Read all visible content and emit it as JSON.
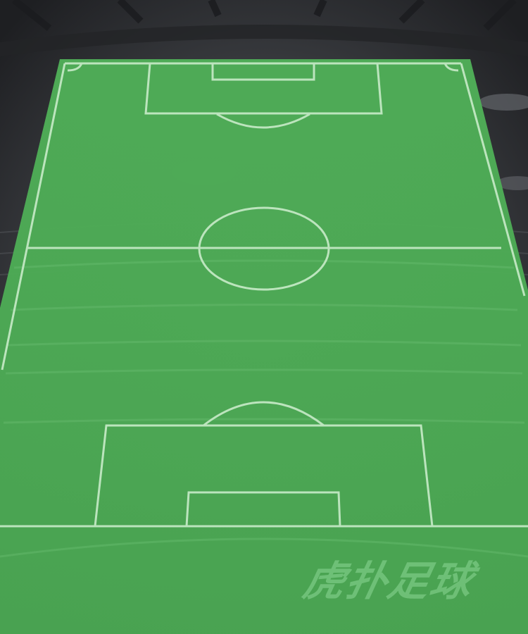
{
  "watermark": {
    "text": "虎扑足球"
  },
  "colors": {
    "stadium_background": "#2b2d30",
    "pitch_green": "#4cae55",
    "pitch_line": "#bfe7c0"
  },
  "pitch": {
    "view": "perspective",
    "orientation": "vertical"
  }
}
